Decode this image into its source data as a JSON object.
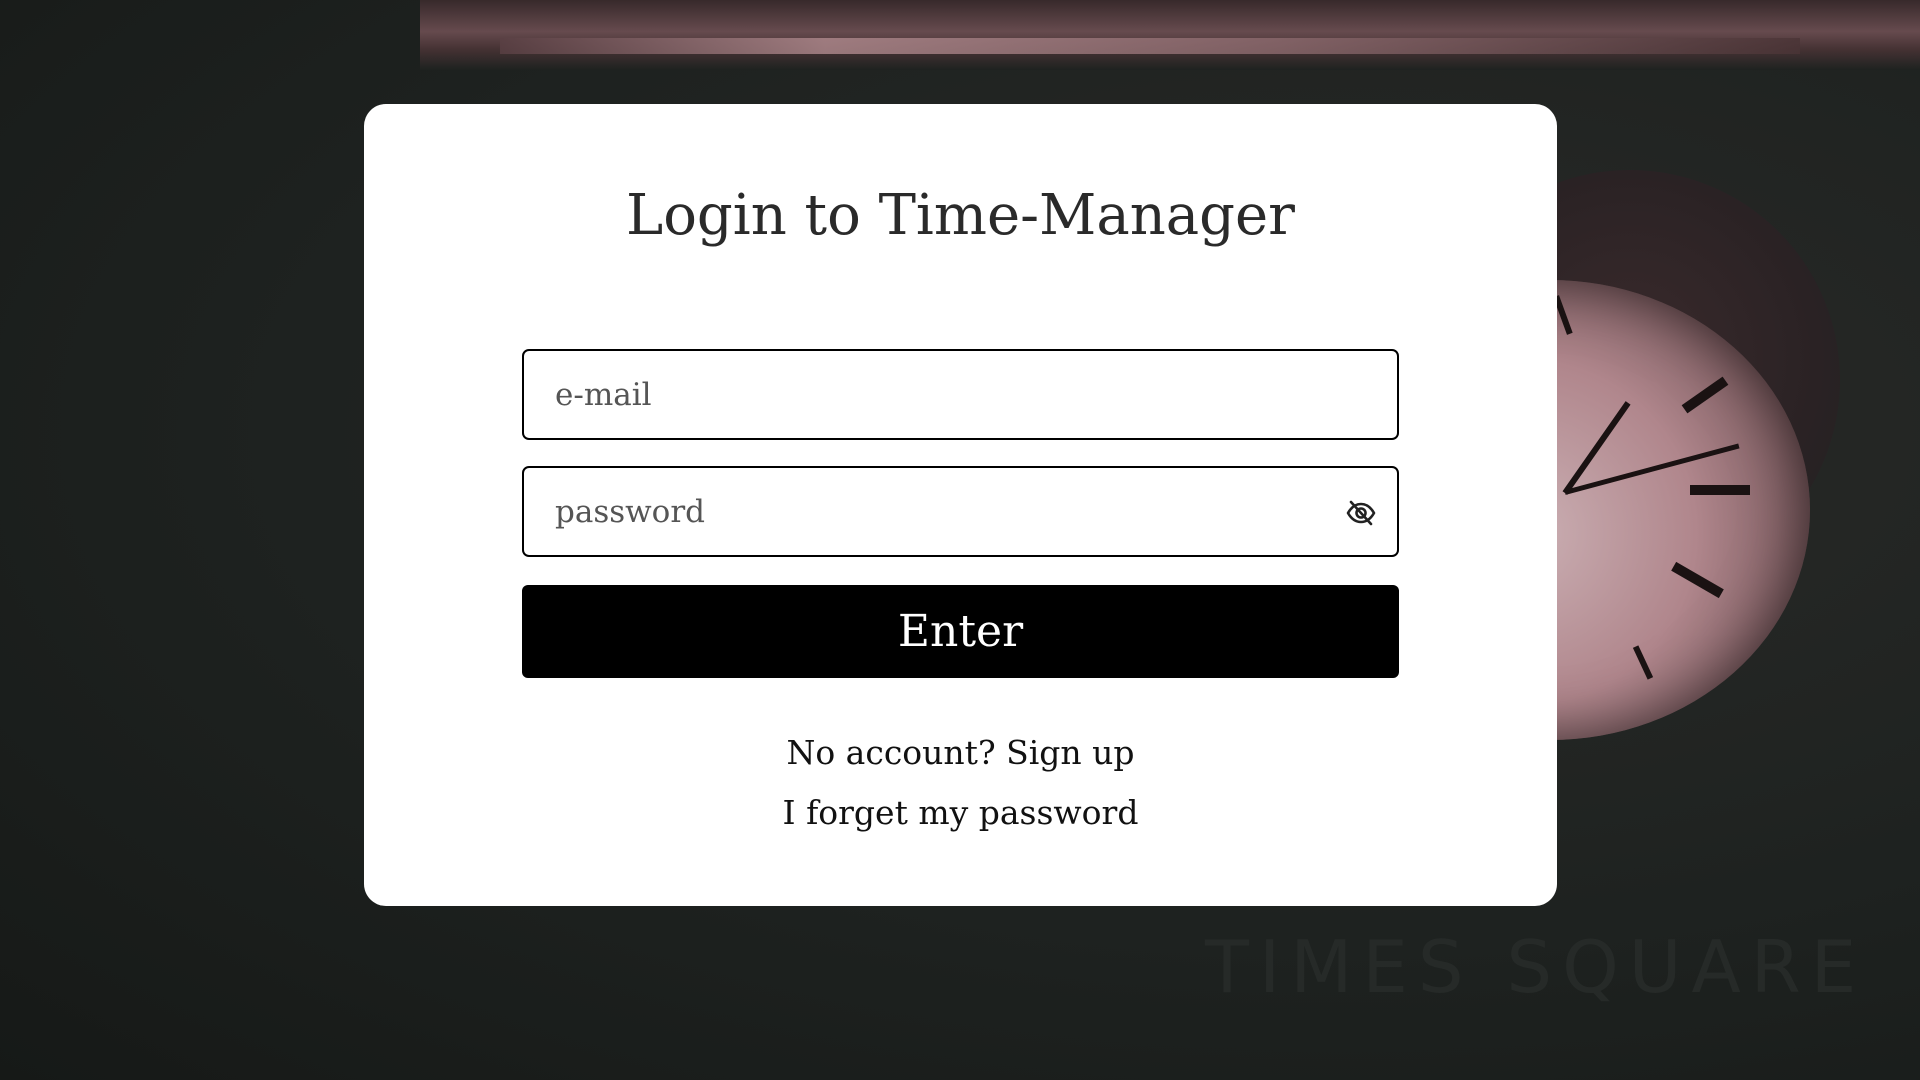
{
  "login": {
    "title": "Login to Time-Manager",
    "email_placeholder": "e-mail",
    "password_placeholder": "password",
    "enter_label": "Enter",
    "signup_link": "No account? Sign up",
    "forgot_link": "I forget my password"
  },
  "background": {
    "watermark": "TIMES SQUARE"
  },
  "icons": {
    "password_toggle": "eye-slash-icon"
  },
  "colors": {
    "page_background": "#1c201e",
    "card_background": "#ffffff",
    "button_background": "#000000",
    "button_text": "#ffffff",
    "text": "#2a2a2a"
  }
}
